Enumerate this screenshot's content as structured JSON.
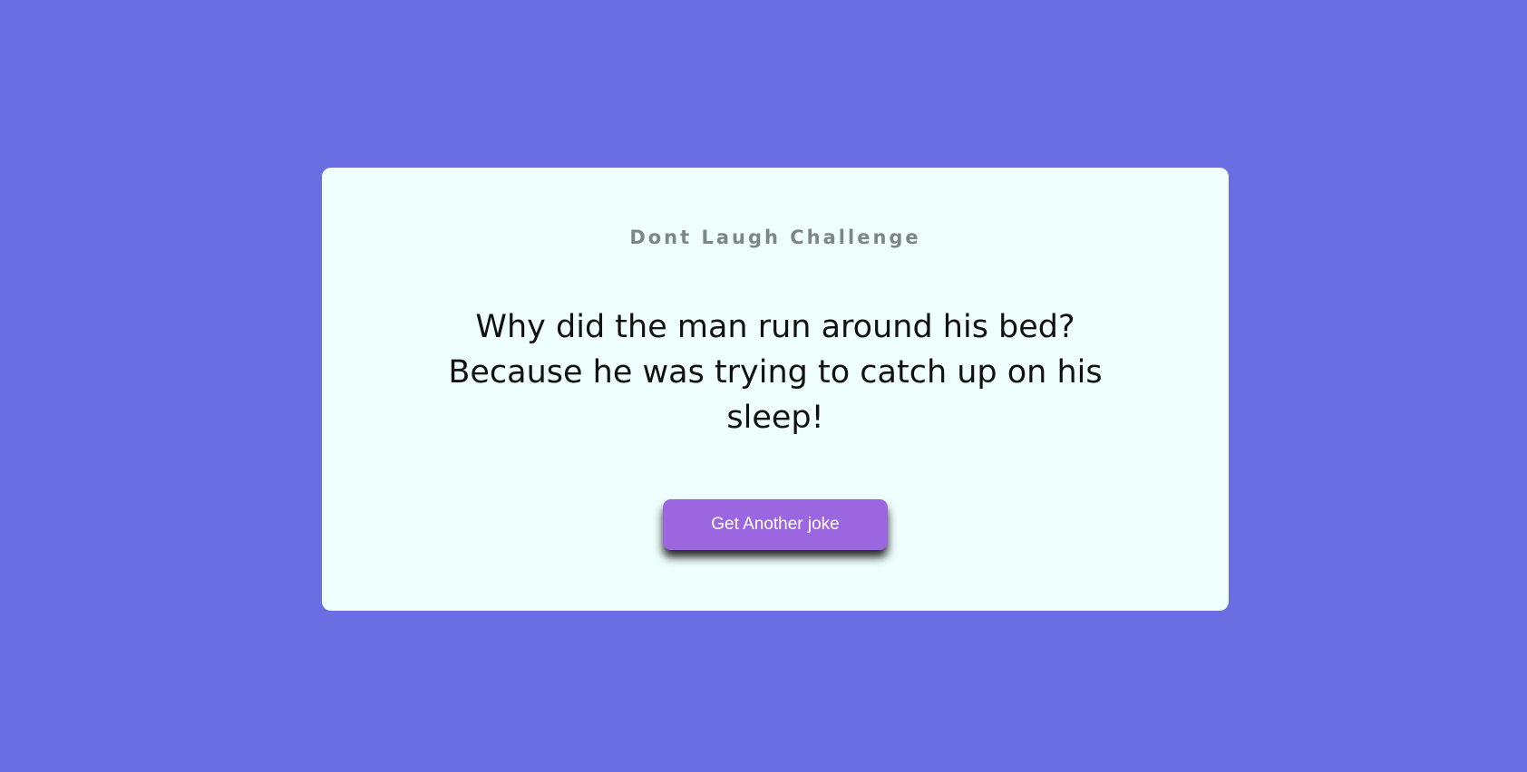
{
  "page": {
    "background_color": "#6a6ee2"
  },
  "card": {
    "background_color": "#effffd",
    "title": "Dont Laugh Challenge",
    "joke": "Why did the man run around his bed? Because he was trying to catch up on his sleep!",
    "button_label": "Get Another joke",
    "button_color": "#9b66df"
  }
}
